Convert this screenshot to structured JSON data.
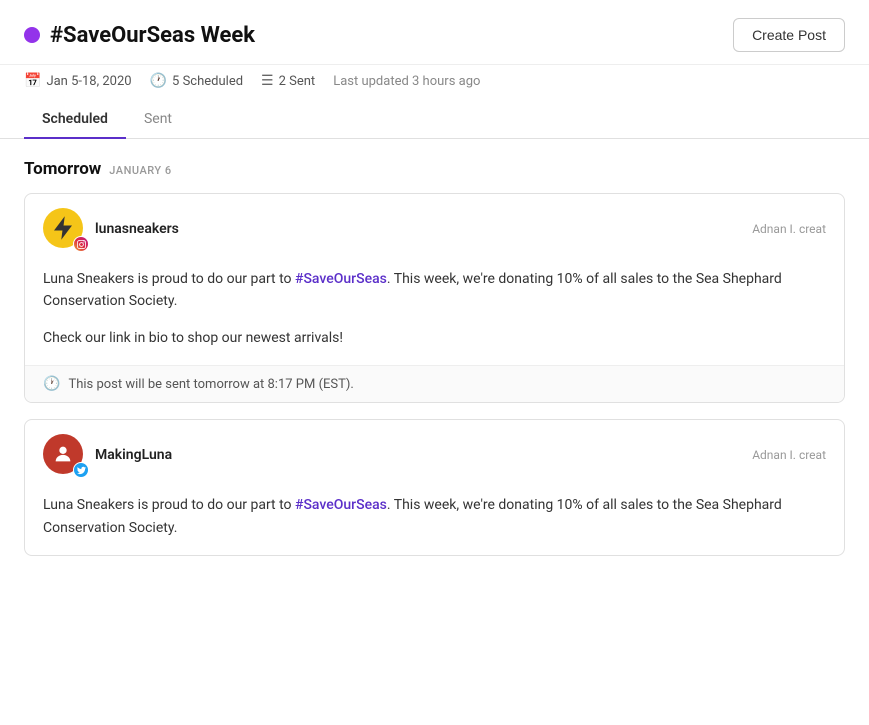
{
  "header": {
    "title": "#SaveOurSeas Week",
    "create_post_label": "Create Post"
  },
  "meta": {
    "date_range": "Jan 5-18, 2020",
    "scheduled_count": "5 Scheduled",
    "sent_count": "2 Sent",
    "last_updated": "Last updated 3 hours ago"
  },
  "tabs": [
    {
      "label": "Scheduled",
      "active": true
    },
    {
      "label": "Sent",
      "active": false
    }
  ],
  "sections": [
    {
      "day": "Tomorrow",
      "date": "JANUARY 6",
      "posts": [
        {
          "account": "lunasneakers",
          "social": "instagram",
          "avatar_emoji": "⚡",
          "avatar_bg": "#f5c518",
          "creator": "Adnan I. creat",
          "body_paragraphs": [
            "Luna Sneakers is proud to do our part to #SaveOurSeas. This week, we're donating 10% of all sales to the Sea Shephard Conservation Society.",
            "Check our link in bio to shop our newest arrivals!"
          ],
          "hashtag_word": "#SaveOurSeas",
          "schedule_text": "This post will be sent tomorrow at 8:17 PM (EST)."
        },
        {
          "account": "MakingLuna",
          "social": "twitter",
          "avatar_emoji": "👤",
          "avatar_bg": "#c0392b",
          "creator": "Adnan I. creat",
          "body_paragraphs": [
            "Luna Sneakers is proud to do our part to #SaveOurSeas. This week, we're donating 10% of all sales to the Sea Shephard Conservation Society."
          ],
          "hashtag_word": "#SaveOurSeas",
          "schedule_text": ""
        }
      ]
    }
  ]
}
